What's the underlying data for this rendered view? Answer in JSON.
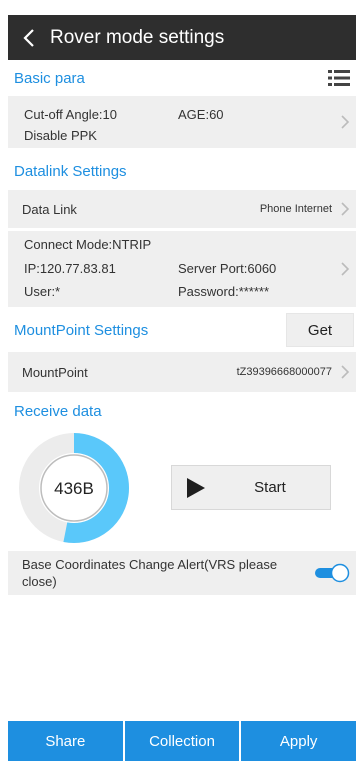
{
  "header": {
    "title": "Rover mode settings"
  },
  "basic": {
    "section_title": "Basic para",
    "cutoff": "Cut-off Angle:10",
    "age": "AGE:60",
    "ppk": "Disable PPK"
  },
  "datalink": {
    "section_title": "Datalink Settings",
    "label": "Data Link",
    "value": "Phone Internet",
    "connect_mode": "Connect Mode:NTRIP",
    "ip": "IP:120.77.83.81",
    "server_port": "Server Port:6060",
    "user": "User:*",
    "password": "Password:******"
  },
  "mountpoint": {
    "section_title": "MountPoint Settings",
    "get_label": "Get",
    "label": "MountPoint",
    "value": "tZ39396668000077"
  },
  "receive": {
    "section_title": "Receive data",
    "amount": "436B",
    "progress_fraction": 0.53,
    "start_label": "Start"
  },
  "alert": {
    "text": "Base Coordinates Change Alert(VRS please close)",
    "enabled": true
  },
  "bottom": {
    "share": "Share",
    "collection": "Collection",
    "apply": "Apply"
  },
  "colors": {
    "accent": "#1e8fe0",
    "header_bg": "#2e2e2e",
    "row_bg": "#efefef",
    "ring": "#5ac8fa"
  },
  "icons": [
    "chevron-left-icon",
    "list-settings-icon",
    "chevron-right-icon",
    "play-icon",
    "toggle-switch-icon"
  ]
}
